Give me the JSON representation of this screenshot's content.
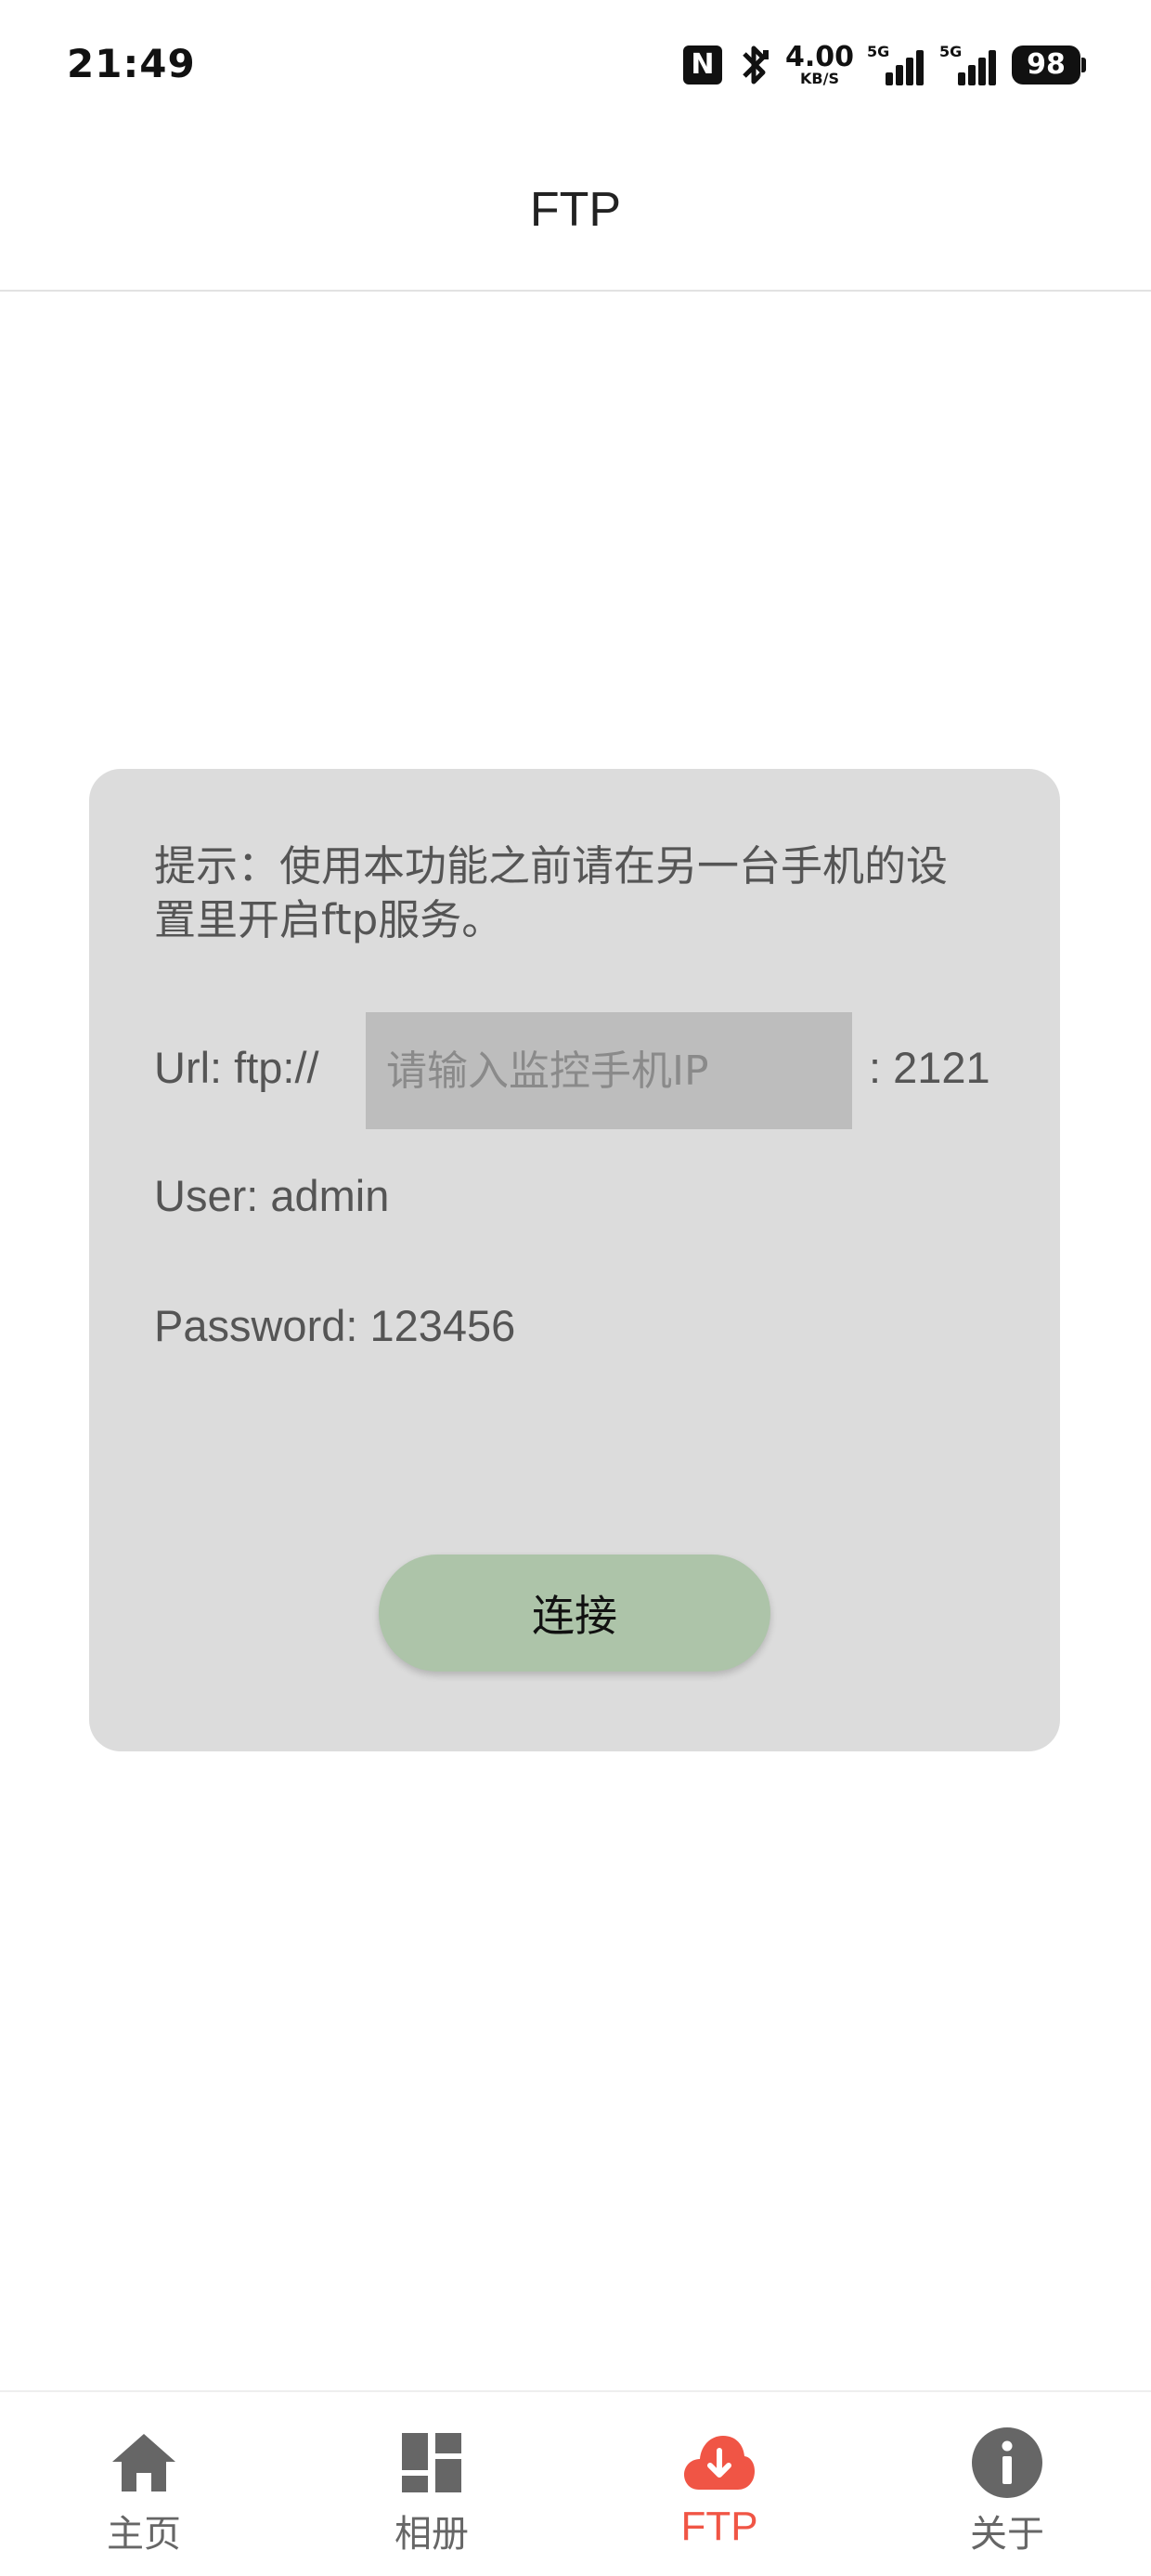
{
  "status_bar": {
    "time": "21:49",
    "nfc_glyph": "N",
    "net_speed_value": "4.00",
    "net_speed_unit": "KB/S",
    "signal1_label": "5G",
    "signal2_label": "5G",
    "battery": "98"
  },
  "header": {
    "title": "FTP"
  },
  "card": {
    "tip": "提示：使用本功能之前请在另一台手机的设置里开启ftp服务。",
    "url_label": "Url: ftp://",
    "ip_input_value": "",
    "ip_input_placeholder": "请输入监控手机IP",
    "port_label": ": 2121",
    "user_label": "User: admin",
    "password_label": "Password: 123456",
    "connect_label": "连接"
  },
  "colors": {
    "accent": "#f05545",
    "card_bg": "#dcdcdc",
    "button_bg": "#adc4a9",
    "icon_gray": "#666666"
  },
  "bottom_nav": {
    "items": [
      {
        "label": "主页",
        "icon": "home-icon"
      },
      {
        "label": "相册",
        "icon": "dashboard-icon"
      },
      {
        "label": "FTP",
        "icon": "cloud-download-icon",
        "active": true
      },
      {
        "label": "关于",
        "icon": "info-icon"
      }
    ]
  }
}
